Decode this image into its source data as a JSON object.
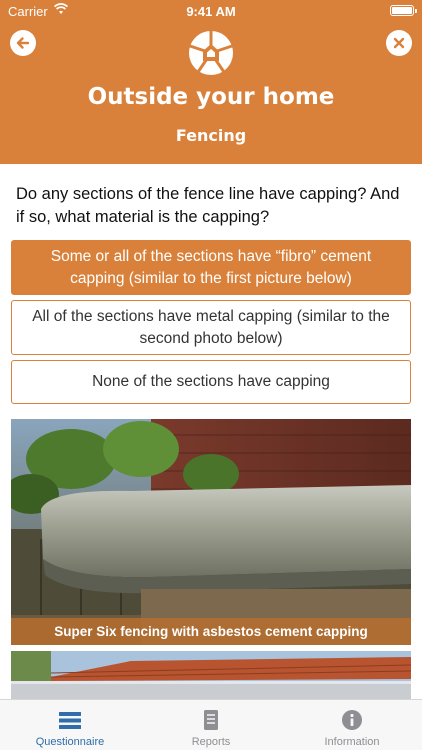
{
  "status_bar": {
    "carrier": "Carrier",
    "time": "9:41 AM"
  },
  "header": {
    "title": "Outside your home",
    "subtitle": "Fencing",
    "back_icon": "arrow-left-icon",
    "close_icon": "close-icon",
    "logo_icon": "home-logo-icon",
    "background_color": "#d9813a"
  },
  "question": {
    "text": "Do any sections of the fence line have capping? And if so, what material is the capping?"
  },
  "options": [
    {
      "label": "Some or all of the sections have “fibro” cement capping (similar to the first picture below)",
      "selected": true
    },
    {
      "label": "All of the sections have metal capping (similar to the second photo below)",
      "selected": false
    },
    {
      "label": "None of the sections have capping",
      "selected": false
    }
  ],
  "photos": [
    {
      "caption": "Super Six fencing with asbestos cement capping"
    },
    {
      "caption": ""
    }
  ],
  "tabbar": {
    "tabs": [
      {
        "label": "Questionnaire",
        "icon": "list-icon",
        "active": true
      },
      {
        "label": "Reports",
        "icon": "document-icon",
        "active": false
      },
      {
        "label": "Information",
        "icon": "info-icon",
        "active": false
      }
    ],
    "active_color": "#2f6ea9",
    "inactive_color": "#8e8e93"
  }
}
